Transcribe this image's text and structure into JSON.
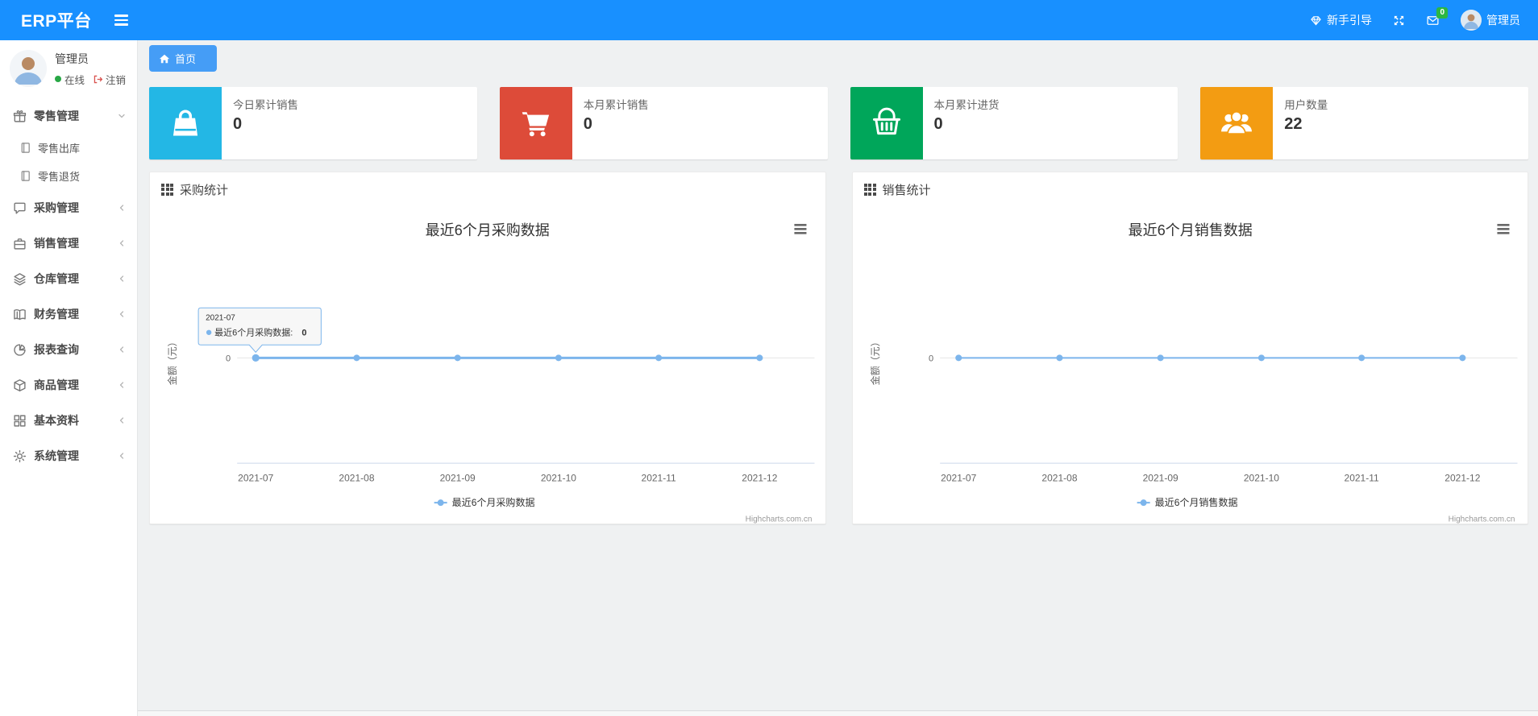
{
  "navbar": {
    "brand": "ERP平台",
    "guide_label": "新手引导",
    "message_badge": "0",
    "user_label": "管理员"
  },
  "sidebar": {
    "user": {
      "name": "管理员",
      "status": "在线",
      "logout": "注销"
    },
    "items": [
      {
        "label": "零售管理"
      },
      {
        "label": "零售出库"
      },
      {
        "label": "零售退货"
      },
      {
        "label": "采购管理"
      },
      {
        "label": "销售管理"
      },
      {
        "label": "仓库管理"
      },
      {
        "label": "财务管理"
      },
      {
        "label": "报表查询"
      },
      {
        "label": "商品管理"
      },
      {
        "label": "基本资料"
      },
      {
        "label": "系统管理"
      }
    ]
  },
  "breadcrumb": {
    "home": "首页"
  },
  "cards": [
    {
      "label": "今日累计销售",
      "value": "0",
      "color": "#23b7e5",
      "icon": "shopping-bag-icon"
    },
    {
      "label": "本月累计销售",
      "value": "0",
      "color": "#dd4b39",
      "icon": "cart-icon"
    },
    {
      "label": "本月累计进货",
      "value": "0",
      "color": "#00a65a",
      "icon": "basket-icon"
    },
    {
      "label": "用户数量",
      "value": "22",
      "color": "#f39c12",
      "icon": "users-icon"
    }
  ],
  "panels": [
    {
      "title": "采购统计"
    },
    {
      "title": "销售统计"
    }
  ],
  "chart_data": [
    {
      "type": "line",
      "title": "最近6个月采购数据",
      "categories": [
        "2021-07",
        "2021-08",
        "2021-09",
        "2021-10",
        "2021-11",
        "2021-12"
      ],
      "values": [
        0,
        0,
        0,
        0,
        0,
        0
      ],
      "ylabel": "金额（元）",
      "ytick": "0",
      "ylim": [
        0,
        null
      ],
      "grid": "zero-line only",
      "legend": "最近6个月采购数据",
      "legend_position": "bottom",
      "line_color": "#7cb5ec",
      "credits": "Highcharts.com.cn",
      "tooltip": {
        "date": "2021-07",
        "label": "最近6个月采购数据:",
        "value": "0"
      }
    },
    {
      "type": "line",
      "title": "最近6个月销售数据",
      "categories": [
        "2021-07",
        "2021-08",
        "2021-09",
        "2021-10",
        "2021-11",
        "2021-12"
      ],
      "values": [
        0,
        0,
        0,
        0,
        0,
        0
      ],
      "ylabel": "金额（元）",
      "ytick": "0",
      "ylim": [
        0,
        null
      ],
      "grid": "zero-line only",
      "legend": "最近6个月销售数据",
      "legend_position": "bottom",
      "line_color": "#7cb5ec",
      "credits": "Highcharts.com.cn"
    }
  ]
}
